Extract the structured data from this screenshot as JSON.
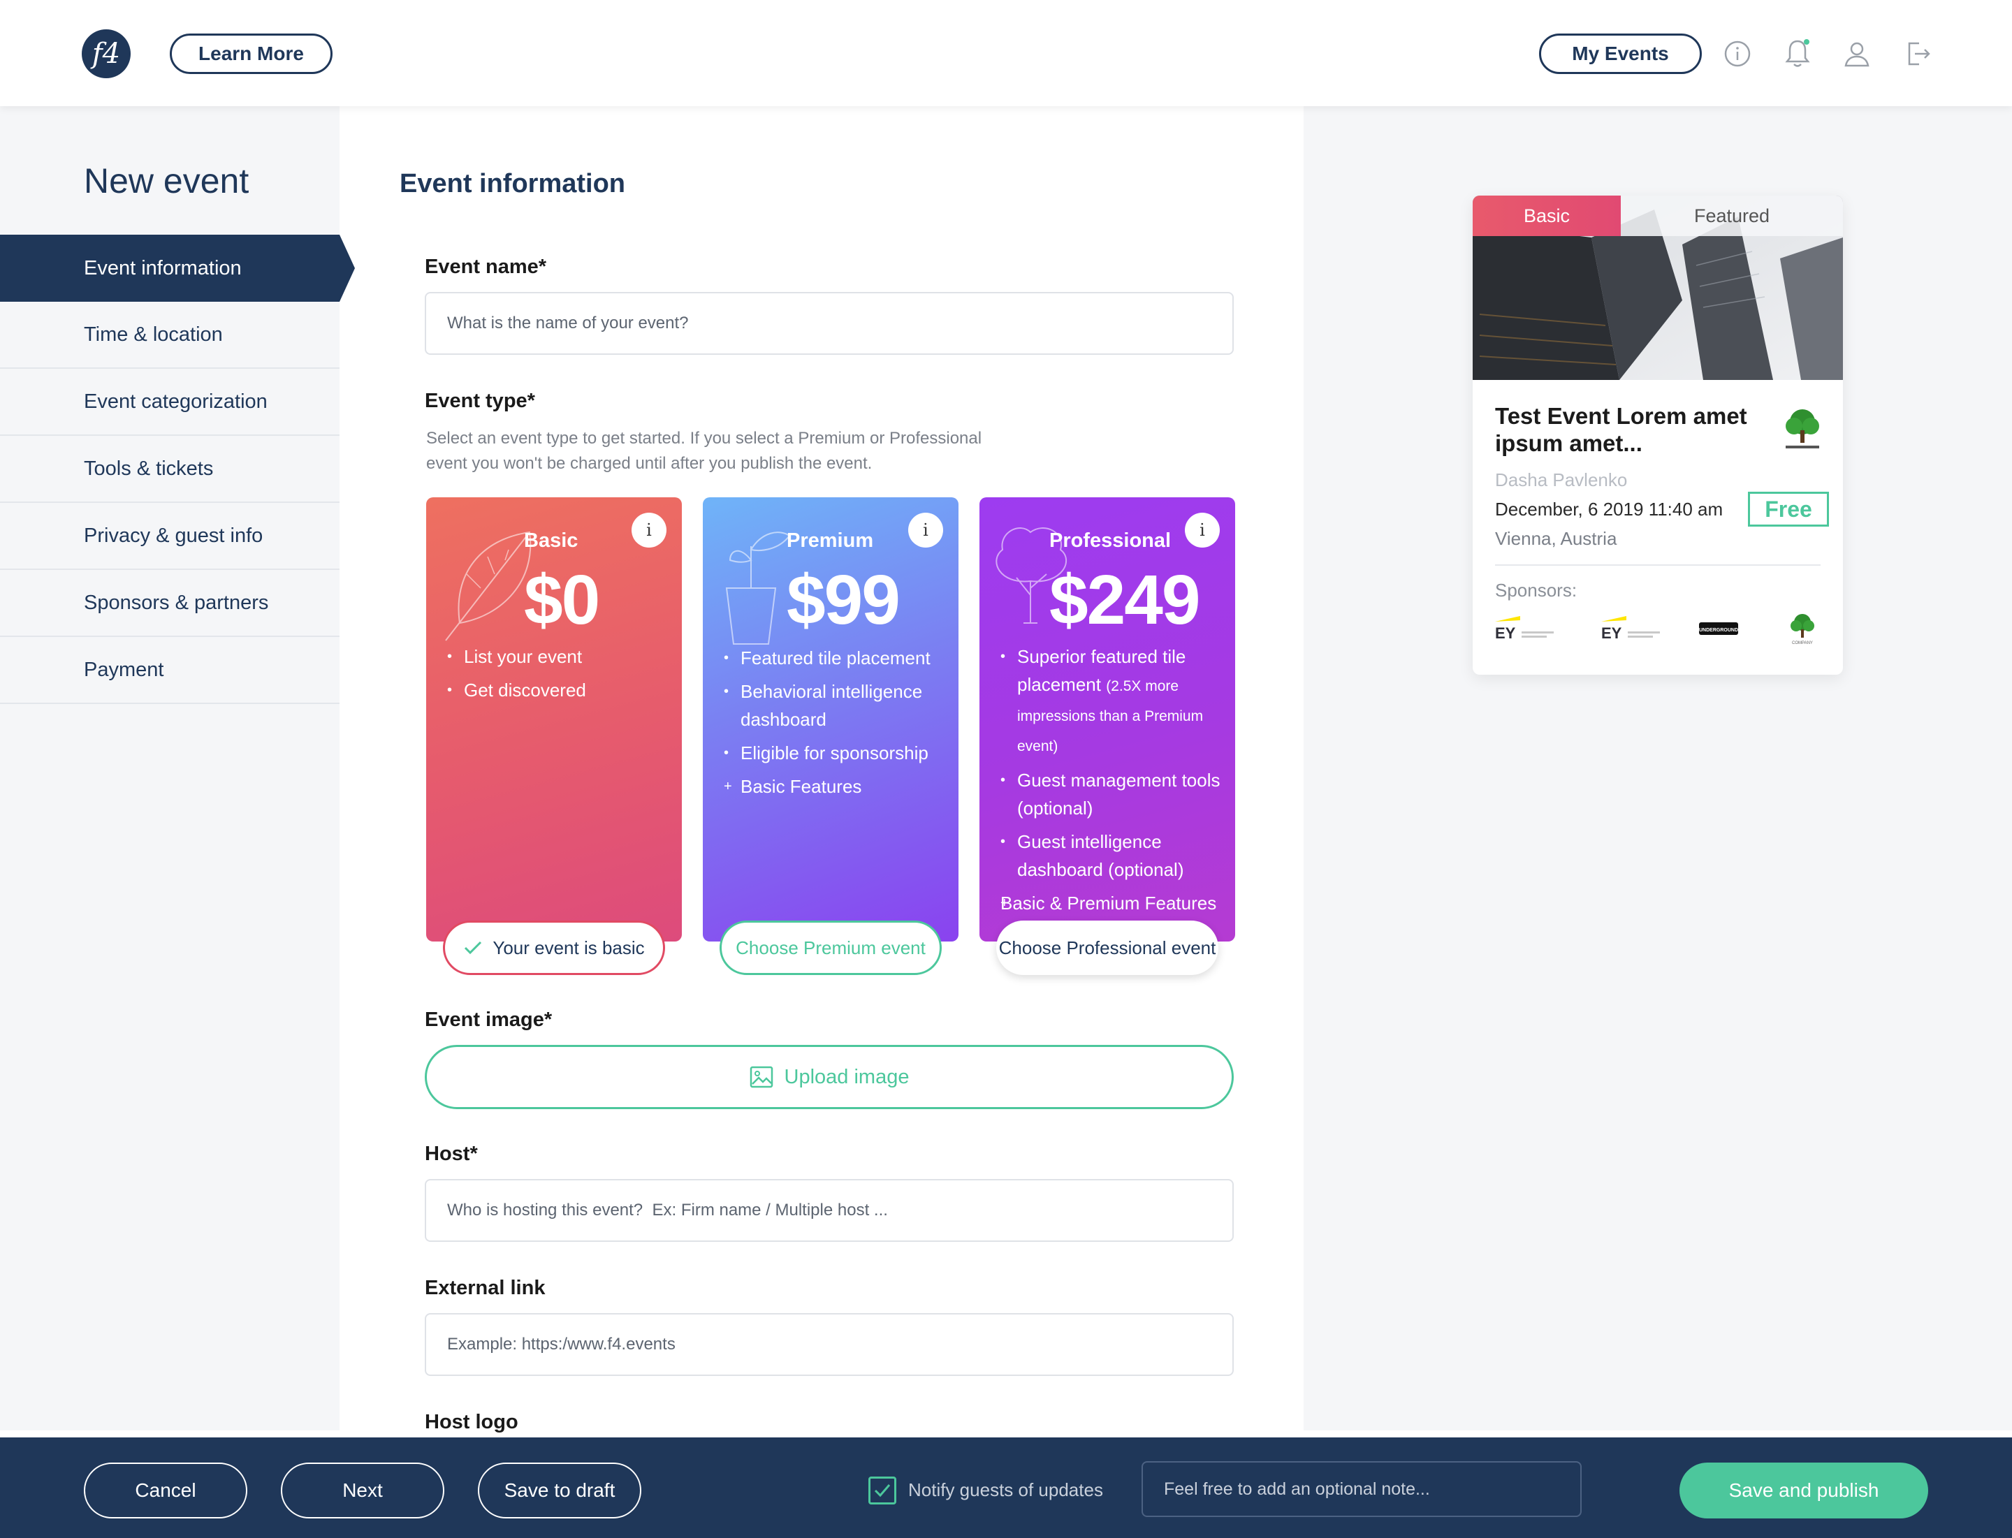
{
  "header": {
    "logo_text": "f4",
    "learn_more": "Learn More",
    "my_events": "My Events",
    "icons": [
      "info-icon",
      "bell-icon",
      "user-icon",
      "logout-icon"
    ]
  },
  "sidebar": {
    "title": "New event",
    "items": [
      {
        "label": "Event information",
        "active": true
      },
      {
        "label": "Time & location"
      },
      {
        "label": "Event categorization"
      },
      {
        "label": "Tools & tickets"
      },
      {
        "label": "Privacy & guest info"
      },
      {
        "label": "Sponsors & partners"
      },
      {
        "label": "Payment"
      }
    ]
  },
  "form": {
    "section_title": "Event information",
    "event_name": {
      "label": "Event name*",
      "placeholder": "What is the name of your event?"
    },
    "event_type": {
      "label": "Event type*",
      "helper": "Select an event type to get started. If you select a Premium or Professional event you won't be charged until after you publish the event.",
      "cards": [
        {
          "name": "Basic",
          "price": "$0",
          "features": [
            "List your event",
            "Get discovered"
          ],
          "button": "Your event is basic"
        },
        {
          "name": "Premium",
          "price": "$99",
          "features": [
            "Featured tile placement",
            "Behavioral intelligence dashboard",
            "Eligible for sponsorship"
          ],
          "extra": "Basic Features",
          "button": "Choose Premium event"
        },
        {
          "name": "Professional",
          "price": "$249",
          "feature1": "Superior featured tile placement",
          "feature1_note": "(2.5X more impressions than a Premium event)",
          "features": [
            "Guest management tools (optional)",
            "Guest intelligence dashboard (optional)"
          ],
          "extra": "Basic & Premium Features",
          "button": "Choose Professional event"
        }
      ]
    },
    "event_image": {
      "label": "Event image*",
      "button": "Upload image"
    },
    "host": {
      "label": "Host*",
      "placeholder": "Who is hosting this event?  Ex: Firm name / Multiple host ..."
    },
    "external_link": {
      "label": "External link",
      "placeholder": "Example: https:/www.f4.events"
    },
    "host_logo": {
      "label": "Host logo"
    }
  },
  "preview": {
    "tab_basic": "Basic",
    "tab_featured": "Featured",
    "title": "Test Event Lorem amet ipsum amet...",
    "host": "Dasha Pavlenko",
    "date": "December, 6 2019 11:40 am",
    "location": "Vienna, Austria",
    "price_badge": "Free",
    "sponsors_label": "Sponsors:",
    "sponsor_logos": [
      "EY",
      "EY",
      "UNDERGROUND",
      "COMPANY"
    ]
  },
  "footer": {
    "cancel": "Cancel",
    "next": "Next",
    "save_draft": "Save to draft",
    "notify_label": "Notify guests of updates",
    "notify_checked": true,
    "note_placeholder": "Feel free to add an optional note...",
    "publish": "Save and publish"
  },
  "colors": {
    "navy": "#1f3759",
    "green": "#4cc79c",
    "basic_red": "#e65b6d",
    "premium_purple": "#7b7ef2",
    "pro_purple": "#a53ae2"
  }
}
